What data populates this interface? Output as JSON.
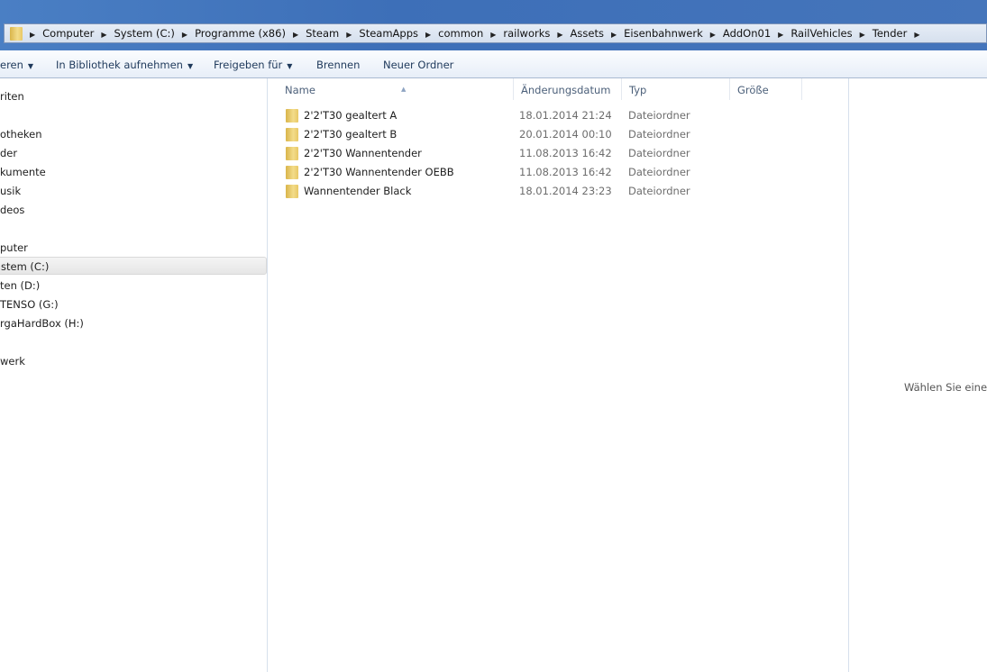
{
  "breadcrumb": [
    "Computer",
    "System (C:)",
    "Programme (x86)",
    "Steam",
    "SteamApps",
    "common",
    "railworks",
    "Assets",
    "Eisenbahnwerk",
    "AddOn01",
    "RailVehicles",
    "Tender"
  ],
  "toolbar": {
    "organize": "eren",
    "library": "In Bibliothek aufnehmen",
    "share": "Freigeben für",
    "burn": "Brennen",
    "new_folder": "Neuer Ordner"
  },
  "sidebar": [
    "riten",
    "otheken",
    "der",
    "kumente",
    "usik",
    "deos",
    "puter",
    "stem (C:)",
    "ten (D:)",
    "TENSO (G:)",
    "rgaHardBox (H:)",
    "werk"
  ],
  "columns": {
    "name": "Name",
    "date": "Änderungsdatum",
    "type": "Typ",
    "size": "Größe"
  },
  "files": [
    {
      "name": "2'2'T30 gealtert A",
      "date": "18.01.2014 21:24",
      "type": "Dateiordner"
    },
    {
      "name": "2'2'T30 gealtert B",
      "date": "20.01.2014 00:10",
      "type": "Dateiordner"
    },
    {
      "name": "2'2'T30 Wannentender",
      "date": "11.08.2013 16:42",
      "type": "Dateiordner"
    },
    {
      "name": "2'2'T30 Wannentender OEBB",
      "date": "11.08.2013 16:42",
      "type": "Dateiordner"
    },
    {
      "name": "Wannentender Black",
      "date": "18.01.2014 23:23",
      "type": "Dateiordner"
    }
  ],
  "preview": {
    "text": "Wählen Sie eine D"
  }
}
